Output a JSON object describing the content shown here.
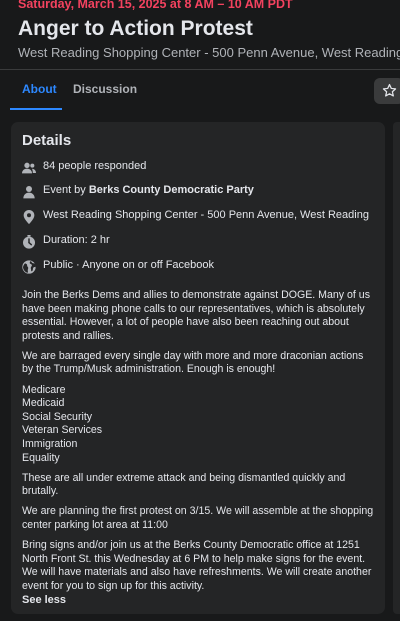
{
  "event": {
    "date": "Saturday, March 15, 2025 at 8 AM – 10 AM PDT",
    "title": "Anger to Action Protest",
    "location": "West Reading Shopping Center - 500 Penn Avenue, West Reading"
  },
  "tabs": {
    "about": "About",
    "discussion": "Discussion"
  },
  "details": {
    "heading": "Details",
    "responded": "84 people responded",
    "host_prefix": "Event by ",
    "host_name": "Berks County Democratic Party",
    "address": "West Reading Shopping Center - 500 Penn Avenue, West Reading",
    "duration": "Duration: 2 hr",
    "privacy": "Public · Anyone on or off Facebook"
  },
  "description": {
    "p1": "Join the Berks Dems and allies to demonstrate against DOGE. Many of us have been making phone calls to our representatives, which is absolutely essential. However, a lot of people have also been reaching out about protests and rallies.",
    "p2": "We are barraged every single day with more and more draconian actions by the Trump/Musk administration. Enough is enough!",
    "list": [
      "Medicare",
      "Medicaid",
      "Social Security",
      "Veteran Services",
      "Immigration",
      "Equality"
    ],
    "p3": "These are all under extreme attack and being dismantled quickly and brutally.",
    "p4": "We are planning the first protest on 3/15. We will assemble at the shopping center parking lot area at 11:00",
    "p5": "Bring signs and/or join us at the Berks County Democratic office at 1251 North Front St. this Wednesday at 6 PM to help make signs for the event. We will have materials and also have refreshments. We will create another event for you to sign up for this activity.",
    "see_less": "See less"
  },
  "colors": {
    "date_red": "#f3425f",
    "accent_blue": "#2d88ff",
    "card_bg": "#242526",
    "page_bg": "#18191a"
  },
  "icons": [
    "people-icon",
    "person-icon",
    "location-pin-icon",
    "clock-icon",
    "globe-icon",
    "star-icon"
  ]
}
